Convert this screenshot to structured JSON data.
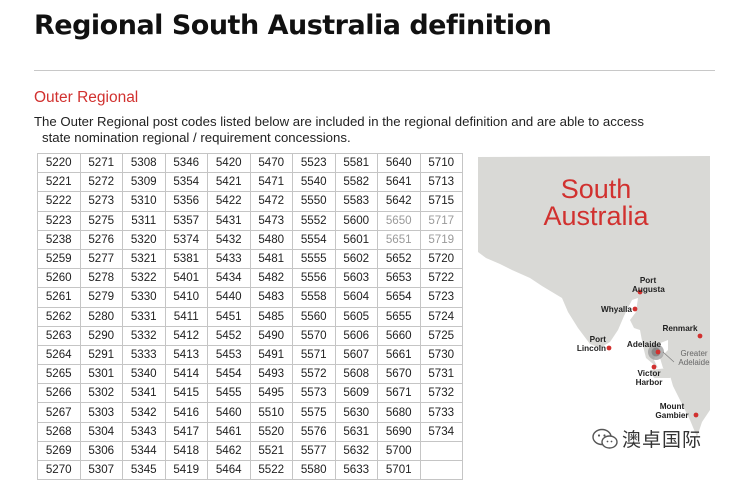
{
  "page": {
    "title": "Regional South Australia definition",
    "subtitle": "Outer Regional",
    "description_line1": "The Outer Regional post codes listed below are included in the regional definition and are able to access",
    "description_line2": "state nomination regional / requirement concessions."
  },
  "postcodes": [
    [
      "5220",
      "5271",
      "5308",
      "5346",
      "5420",
      "5470",
      "5523",
      "5581",
      "5640",
      "5710"
    ],
    [
      "5221",
      "5272",
      "5309",
      "5354",
      "5421",
      "5471",
      "5540",
      "5582",
      "5641",
      "5713"
    ],
    [
      "5222",
      "5273",
      "5310",
      "5356",
      "5422",
      "5472",
      "5550",
      "5583",
      "5642",
      "5715"
    ],
    [
      "5223",
      "5275",
      "5311",
      "5357",
      "5431",
      "5473",
      "5552",
      "5600",
      "5650",
      "5717"
    ],
    [
      "5238",
      "5276",
      "5320",
      "5374",
      "5432",
      "5480",
      "5554",
      "5601",
      "5651",
      "5719"
    ],
    [
      "5259",
      "5277",
      "5321",
      "5381",
      "5433",
      "5481",
      "5555",
      "5602",
      "5652",
      "5720"
    ],
    [
      "5260",
      "5278",
      "5322",
      "5401",
      "5434",
      "5482",
      "5556",
      "5603",
      "5653",
      "5722"
    ],
    [
      "5261",
      "5279",
      "5330",
      "5410",
      "5440",
      "5483",
      "5558",
      "5604",
      "5654",
      "5723"
    ],
    [
      "5262",
      "5280",
      "5331",
      "5411",
      "5451",
      "5485",
      "5560",
      "5605",
      "5655",
      "5724"
    ],
    [
      "5263",
      "5290",
      "5332",
      "5412",
      "5452",
      "5490",
      "5570",
      "5606",
      "5660",
      "5725"
    ],
    [
      "5264",
      "5291",
      "5333",
      "5413",
      "5453",
      "5491",
      "5571",
      "5607",
      "5661",
      "5730"
    ],
    [
      "5265",
      "5301",
      "5340",
      "5414",
      "5454",
      "5493",
      "5572",
      "5608",
      "5670",
      "5731"
    ],
    [
      "5266",
      "5302",
      "5341",
      "5415",
      "5455",
      "5495",
      "5573",
      "5609",
      "5671",
      "5732"
    ],
    [
      "5267",
      "5303",
      "5342",
      "5416",
      "5460",
      "5510",
      "5575",
      "5630",
      "5680",
      "5733"
    ],
    [
      "5268",
      "5304",
      "5343",
      "5417",
      "5461",
      "5520",
      "5576",
      "5631",
      "5690",
      "5734"
    ],
    [
      "5269",
      "5306",
      "5344",
      "5418",
      "5462",
      "5521",
      "5577",
      "5632",
      "5700",
      ""
    ],
    [
      "5270",
      "5307",
      "5345",
      "5419",
      "5464",
      "5522",
      "5580",
      "5633",
      "5701",
      ""
    ]
  ],
  "map": {
    "state_line1": "South",
    "state_line2": "Australia",
    "port_augusta": "Port\nAugusta",
    "whyalla": "Whyalla",
    "renmark": "Renmark",
    "port_lincoln": "Port\nLincoln",
    "adelaide": "Adelaide",
    "greater_adelaide": "Greater\nAdelaide",
    "victor_harbor": "Victor\nHarbor",
    "mount_gambier": "Mount\nGambier",
    "land_color": "#d9d9d6",
    "dot_color": "#d1312f"
  },
  "watermark": {
    "text": "澳卓国际",
    "icon": "wechat-icon"
  }
}
